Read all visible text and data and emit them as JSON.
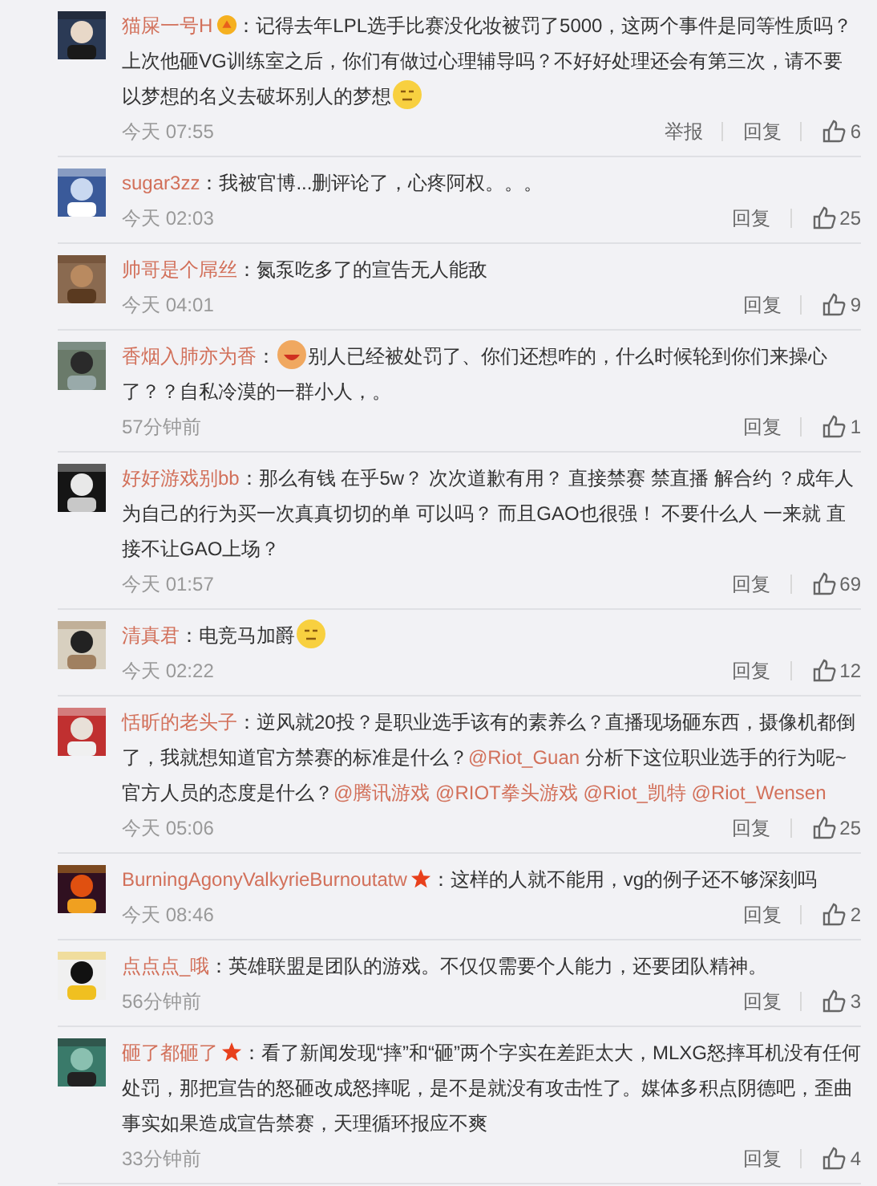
{
  "comments": [
    {
      "user": "猫屎一号H",
      "vip": true,
      "starred": false,
      "separator": "：",
      "emoji_start": false,
      "body": [
        {
          "kind": "text",
          "text": "记得去年LPL选手比赛没化妆被罚了5000，这两个事件是同等性质吗？上次他砸VG训练室之后，你们有做过心理辅导吗？不好好处理还会有第三次，请不要以梦想的名义去破坏别人的梦想"
        }
      ],
      "emoji_end": true,
      "time": "今天 07:55",
      "actions": [
        "举报",
        "回复"
      ],
      "likes": "6"
    },
    {
      "user": "sugar3zz",
      "vip": false,
      "starred": false,
      "separator": "：",
      "emoji_start": false,
      "body": [
        {
          "kind": "text",
          "text": "我被官博...删评论了，心疼阿权。。。"
        }
      ],
      "emoji_end": false,
      "time": "今天 02:03",
      "actions": [
        "回复"
      ],
      "likes": "25"
    },
    {
      "user": "帅哥是个屌丝",
      "vip": false,
      "starred": false,
      "separator": "：",
      "emoji_start": false,
      "body": [
        {
          "kind": "text",
          "text": "氮泵吃多了的宣告无人能敌"
        }
      ],
      "emoji_end": false,
      "time": "今天 04:01",
      "actions": [
        "回复"
      ],
      "likes": "9"
    },
    {
      "user": "香烟入肺亦为香",
      "vip": false,
      "starred": false,
      "separator": "：",
      "emoji_start": true,
      "body": [
        {
          "kind": "text",
          "text": "别人已经被处罚了、你们还想咋的，什么时候轮到你们来操心了？？自私冷漠的一群小人，。"
        }
      ],
      "emoji_end": false,
      "time": "57分钟前",
      "actions": [
        "回复"
      ],
      "likes": "1"
    },
    {
      "user": "好好游戏别bb",
      "vip": false,
      "starred": false,
      "separator": "：",
      "emoji_start": false,
      "body": [
        {
          "kind": "text",
          "text": "那么有钱 在乎5w？ 次次道歉有用？ 直接禁赛 禁直播 解合约 ？成年人为自己的行为买一次真真切切的单 可以吗？ 而且GAO也很强！ 不要什么人 一来就 直接不让GAO上场？"
        }
      ],
      "emoji_end": false,
      "time": "今天 01:57",
      "actions": [
        "回复"
      ],
      "likes": "69"
    },
    {
      "user": "清真君",
      "vip": false,
      "starred": false,
      "separator": "：",
      "emoji_start": false,
      "body": [
        {
          "kind": "text",
          "text": "电竞马加爵"
        }
      ],
      "emoji_end": true,
      "time": "今天 02:22",
      "actions": [
        "回复"
      ],
      "likes": "12"
    },
    {
      "user": "恬昕的老头子",
      "vip": false,
      "starred": false,
      "separator": "：",
      "emoji_start": false,
      "body": [
        {
          "kind": "text",
          "text": "逆风就20投？是职业选手该有的素养么？直播现场砸东西，摄像机都倒了，我就想知道官方禁赛的标准是什么？"
        },
        {
          "kind": "mention",
          "text": "@Riot_Guan"
        },
        {
          "kind": "text",
          "text": " 分析下这位职业选手的行为呢~官方人员的态度是什么？"
        },
        {
          "kind": "mention",
          "text": "@腾讯游戏"
        },
        {
          "kind": "mention",
          "text": "@RIOT拳头游戏"
        },
        {
          "kind": "mention",
          "text": "@Riot_凯特"
        },
        {
          "kind": "mention",
          "text": "@Riot_Wensen"
        }
      ],
      "emoji_end": false,
      "time": "今天 05:06",
      "actions": [
        "回复"
      ],
      "likes": "25"
    },
    {
      "user": "BurningAgonyValkyrieBurnoutatw",
      "vip": false,
      "starred": true,
      "separator": "：",
      "emoji_start": false,
      "body": [
        {
          "kind": "text",
          "text": "这样的人就不能用，vg的例子还不够深刻吗"
        }
      ],
      "emoji_end": false,
      "time": "今天 08:46",
      "actions": [
        "回复"
      ],
      "likes": "2"
    },
    {
      "user": "点点点_哦",
      "vip": false,
      "starred": false,
      "separator": "：",
      "emoji_start": false,
      "body": [
        {
          "kind": "text",
          "text": "英雄联盟是团队的游戏。不仅仅需要个人能力，还要团队精神。"
        }
      ],
      "emoji_end": false,
      "time": "56分钟前",
      "actions": [
        "回复"
      ],
      "likes": "3"
    },
    {
      "user": "砸了都砸了",
      "vip": false,
      "starred": true,
      "separator": "：",
      "emoji_start": false,
      "body": [
        {
          "kind": "text",
          "text": "看了新闻发现“摔”和“砸”两个字实在差距太大，MLXG怒摔耳机没有任何处罚，那把宣告的怒砸改成怒摔呢，是不是就没有攻击性了。媒体多积点阴德吧，歪曲事实如果造成宣告禁赛，天理循环报应不爽"
        }
      ],
      "emoji_end": false,
      "time": "33分钟前",
      "actions": [
        "回复"
      ],
      "likes": "4"
    }
  ]
}
